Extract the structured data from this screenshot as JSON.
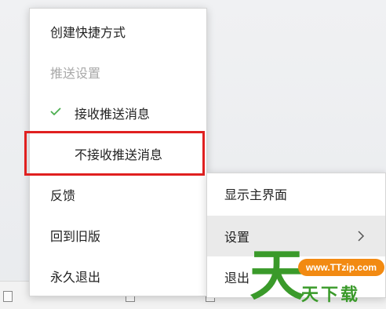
{
  "main_menu": {
    "items": [
      {
        "label": "创建快捷方式"
      },
      {
        "label": "推送设置"
      },
      {
        "label": "接收推送消息"
      },
      {
        "label": "不接收推送消息"
      },
      {
        "label": "反馈"
      },
      {
        "label": "回到旧版"
      },
      {
        "label": "永久退出"
      }
    ]
  },
  "sub_menu": {
    "items": [
      {
        "label": "显示主界面"
      },
      {
        "label": "设置"
      },
      {
        "label": "退出"
      }
    ]
  },
  "watermark": {
    "big_char": "天",
    "badge": "www.TTzip.com",
    "slogan": "天下载"
  },
  "colors": {
    "check": "#4caf50",
    "highlight": "#e02020",
    "watermark_green": "#3a9a2a",
    "watermark_orange": "#f28a12"
  },
  "icons": [
    "check-icon",
    "chevron-right-icon"
  ]
}
